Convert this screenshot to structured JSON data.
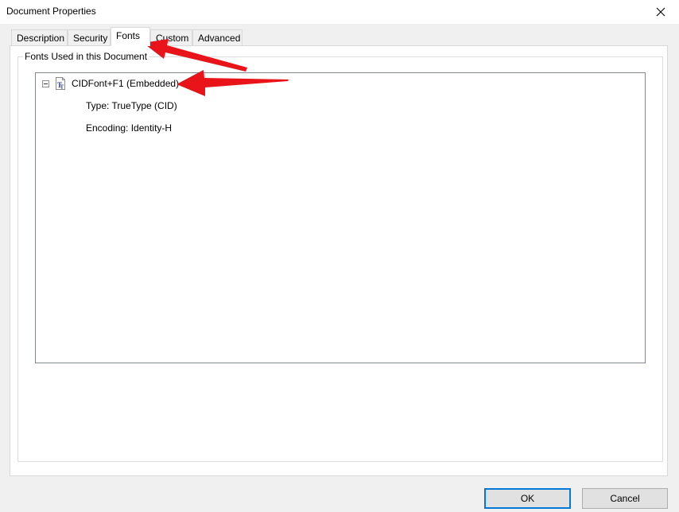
{
  "window": {
    "title": "Document Properties",
    "close_glyph": "✕"
  },
  "tabs": [
    {
      "label": "Description",
      "selected": false
    },
    {
      "label": "Security",
      "selected": false
    },
    {
      "label": "Fonts",
      "selected": true
    },
    {
      "label": "Custom",
      "selected": false
    },
    {
      "label": "Advanced",
      "selected": false
    }
  ],
  "fonts_panel": {
    "group_label": "Fonts Used in this Document",
    "fonts": [
      {
        "name": "CIDFont+F1 (Embedded)",
        "icon": "truetype-font-icon",
        "expanded": true,
        "type": "Type: TrueType (CID)",
        "encoding": "Encoding: Identity-H"
      }
    ]
  },
  "buttons": {
    "ok_label": "OK",
    "cancel_label": "Cancel"
  },
  "colors": {
    "annotation_arrow": "#e8141a",
    "default_button_border": "#0078d7"
  }
}
